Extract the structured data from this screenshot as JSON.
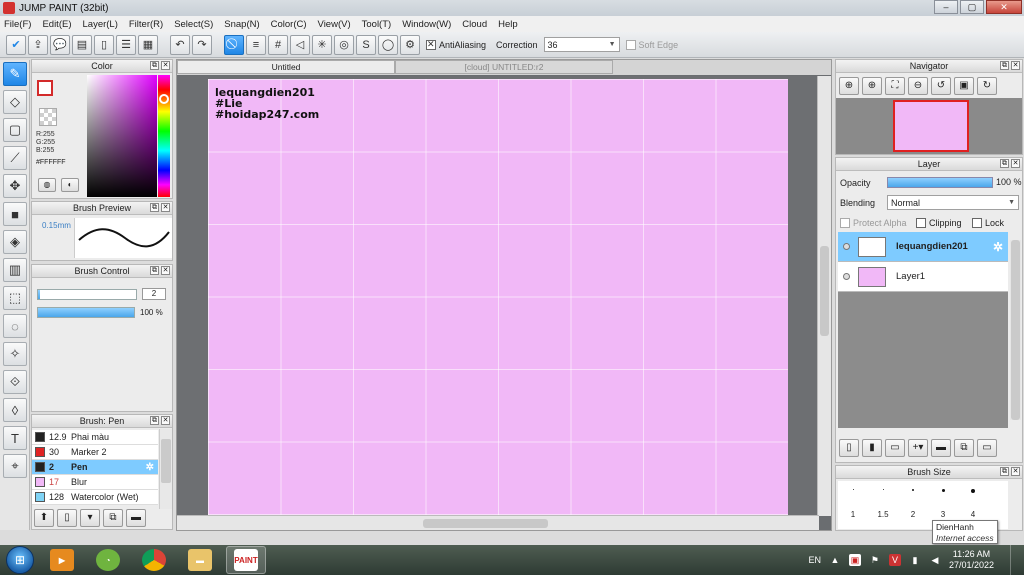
{
  "window": {
    "title": "JUMP PAINT (32bit)",
    "minimize": "–",
    "maximize": "▢",
    "close": "✕"
  },
  "menu": [
    "File(F)",
    "Edit(E)",
    "Layer(L)",
    "Filter(R)",
    "Select(S)",
    "Snap(N)",
    "Color(C)",
    "View(V)",
    "Tool(T)",
    "Window(W)",
    "Cloud",
    "Help"
  ],
  "toolbar": {
    "antialiasing_label": "AntiAliasing",
    "correction_label": "Correction",
    "correction_value": "36",
    "soft_edge_label": "Soft Edge"
  },
  "color_panel": {
    "title": "Color",
    "r": "R:255",
    "g": "G:255",
    "b": "B:255",
    "hex": "#FFFFFF"
  },
  "brush_preview": {
    "title": "Brush Preview",
    "size": "0.15mm"
  },
  "brush_control": {
    "title": "Brush Control",
    "size_value": "2",
    "opacity_value": "100 %",
    "opacity_fraction": 1.0
  },
  "brush_list": {
    "title": "Brush: Pen",
    "items": [
      {
        "size": "12.9",
        "name": "Phai màu",
        "color": "#222222"
      },
      {
        "size": "30",
        "name": "Marker 2",
        "color": "#e02424"
      },
      {
        "size": "2",
        "name": "Pen",
        "color": "#222222"
      },
      {
        "size": "17",
        "name": "Blur",
        "color": "#f1b8f7"
      },
      {
        "size": "128",
        "name": "Watercolor (Wet)",
        "color": "#7fd3f5"
      }
    ]
  },
  "document": {
    "tabs": [
      "Untitled",
      "[cloud] UNTITLED:r2"
    ],
    "canvas_color": "#f1b8f7",
    "canvas_text": [
      "lequangdien201",
      "#Lie",
      "#hoidap247.com"
    ]
  },
  "navigator": {
    "title": "Navigator"
  },
  "layer_panel": {
    "title": "Layer",
    "opacity_label": "Opacity",
    "opacity_value": "100 %",
    "blending_label": "Blending",
    "blending_value": "Normal",
    "protect_alpha": "Protect Alpha",
    "clipping": "Clipping",
    "lock": "Lock",
    "layers": [
      {
        "name": "lequangdien201"
      },
      {
        "name": "Layer1"
      }
    ]
  },
  "brush_size": {
    "title": "Brush Size",
    "values": [
      "1",
      "1.5",
      "2",
      "3",
      "4"
    ]
  },
  "tooltip": {
    "title": "DienHanh",
    "subtitle": "Internet access"
  },
  "taskbar": {
    "language": "EN",
    "time": "11:26 AM",
    "date": "27/01/2022",
    "jumppaint_label": "PAINT"
  }
}
